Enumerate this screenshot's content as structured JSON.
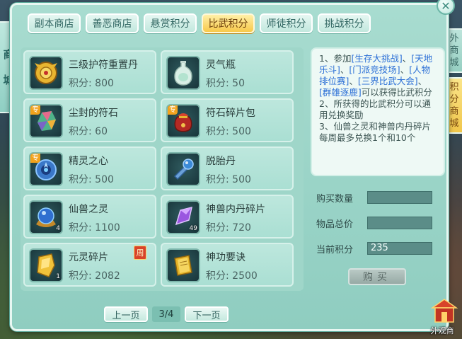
{
  "window": {
    "close_label": "✕"
  },
  "left_strip": {
    "chars": [
      "商",
      "城"
    ]
  },
  "right_tabs": [
    {
      "label": [
        "外",
        "商",
        "城"
      ],
      "active": false
    },
    {
      "label": [
        "积",
        "分",
        "商",
        "城"
      ],
      "active": true
    }
  ],
  "tabs": [
    {
      "label": "副本商店",
      "active": false
    },
    {
      "label": "善恶商店",
      "active": false
    },
    {
      "label": "悬赏积分",
      "active": false
    },
    {
      "label": "比武积分",
      "active": true
    },
    {
      "label": "师徒积分",
      "active": false
    },
    {
      "label": "挑战积分",
      "active": false
    }
  ],
  "score_prefix": "积分: ",
  "items": [
    {
      "name": "三级护符重置丹",
      "score": "积分: 800",
      "icon": "amulet-icon",
      "tag": "",
      "count": "",
      "weekly": ""
    },
    {
      "name": "灵气瓶",
      "score": "积分: 50",
      "icon": "vase-icon",
      "tag": "",
      "count": "",
      "weekly": ""
    },
    {
      "name": "尘封的符石",
      "score": "积分: 60",
      "icon": "rune-stone-icon",
      "tag": "专",
      "count": "",
      "weekly": ""
    },
    {
      "name": "符石碎片包",
      "score": "积分: 500",
      "icon": "bag-icon",
      "tag": "专",
      "count": "",
      "weekly": ""
    },
    {
      "name": "精灵之心",
      "score": "积分: 500",
      "icon": "spirit-heart-icon",
      "tag": "专",
      "count": "",
      "weekly": ""
    },
    {
      "name": "脱胎丹",
      "score": "积分: 500",
      "icon": "pill-icon",
      "tag": "",
      "count": "",
      "weekly": ""
    },
    {
      "name": "仙兽之灵",
      "score": "积分: 1100",
      "icon": "orb-icon",
      "tag": "",
      "count": "4",
      "weekly": ""
    },
    {
      "name": "神兽内丹碎片",
      "score": "积分: 720",
      "icon": "crystal-icon",
      "tag": "",
      "count": "49",
      "weekly": ""
    },
    {
      "name": "元灵碎片",
      "score": "积分: 2082",
      "icon": "gold-shard-icon",
      "tag": "",
      "count": "1",
      "weekly": "周"
    },
    {
      "name": "神功要诀",
      "score": "积分: 2500",
      "icon": "book-icon",
      "tag": "",
      "count": "",
      "weekly": ""
    }
  ],
  "pager": {
    "prev": "上一页",
    "page": "3/4",
    "next": "下一页"
  },
  "info": {
    "p1": [
      "1、参加",
      "[生存大挑战]",
      "、",
      "[天地乐斗]",
      "、",
      "[门派竞技场]",
      "、",
      "[人物排位赛]",
      "、",
      "[三界比武大会]",
      "、",
      "[群雄逐鹿]",
      "可以获得比武积分"
    ],
    "p2": "2、所获得的比武积分可以通用兑换奖励",
    "p3": "3、仙兽之灵和神兽内丹碎片每周最多兑换1个和10个"
  },
  "form": {
    "qty_label": "购买数量",
    "qty_value": "",
    "total_label": "物品总价",
    "total_value": "",
    "current_label": "当前积分",
    "current_value": "235"
  },
  "buy_label": "购买",
  "shop_icon_label": "外观商"
}
